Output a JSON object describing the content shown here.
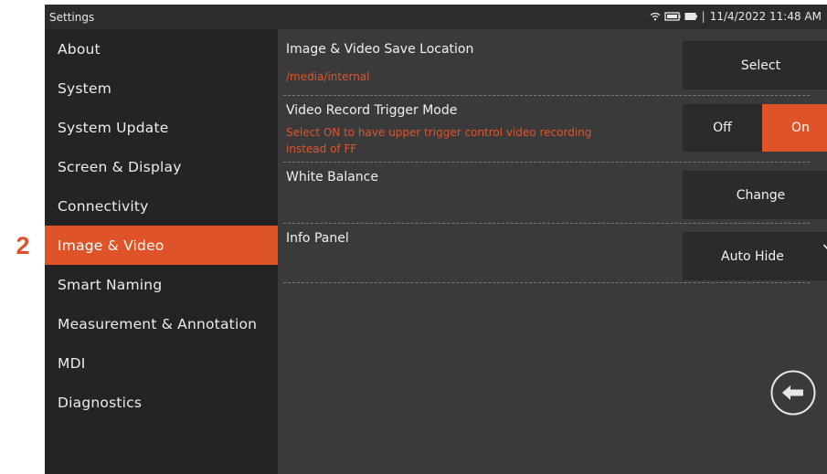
{
  "callout": {
    "number": "2"
  },
  "status": {
    "title": "Settings",
    "separator": "|",
    "datetime": "11/4/2022  11:48 AM",
    "icons": [
      "wifi-icon",
      "storage-icon",
      "battery-icon"
    ]
  },
  "sidebar": {
    "items": [
      {
        "label": "About"
      },
      {
        "label": "System"
      },
      {
        "label": "System Update"
      },
      {
        "label": "Screen & Display"
      },
      {
        "label": "Connectivity"
      },
      {
        "label": "Image & Video"
      },
      {
        "label": "Smart Naming"
      },
      {
        "label": "Measurement & Annotation"
      },
      {
        "label": "MDI"
      },
      {
        "label": "Diagnostics"
      }
    ],
    "active": "Image & Video"
  },
  "settings": {
    "save_location": {
      "title": "Image & Video Save Location",
      "value": "/media/internal",
      "button": "Select"
    },
    "trigger_mode": {
      "title": "Video Record Trigger Mode",
      "desc_line1": "Select ON to have upper trigger control video recording",
      "desc_line2": "instead of FF",
      "off_label": "Off",
      "on_label": "On",
      "selected": "On"
    },
    "white_balance": {
      "title": "White Balance",
      "button": "Change"
    },
    "info_panel": {
      "title": "Info Panel",
      "selected": "Auto Hide"
    }
  },
  "colors": {
    "accent": "#de5328",
    "sidebar_bg": "#242424",
    "content_bg": "#3a3a3a",
    "button_bg": "#2b2b2b"
  }
}
